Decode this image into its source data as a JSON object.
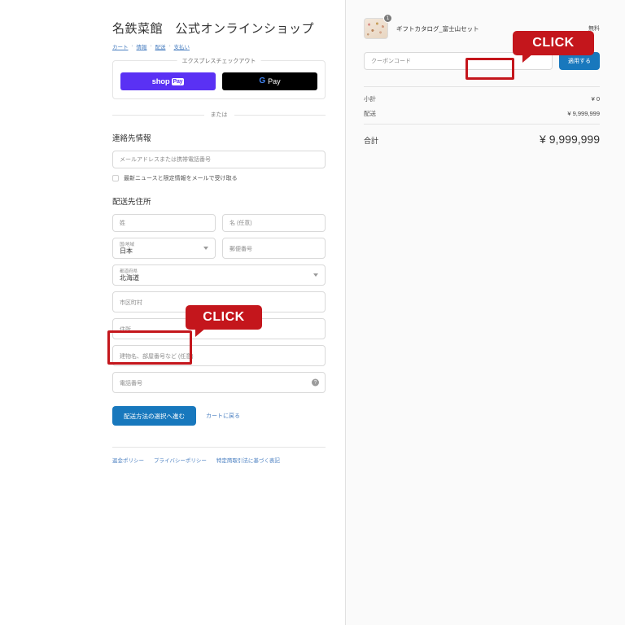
{
  "header": {
    "shop_title": "名鉄菜館　公式オンラインショップ"
  },
  "breadcrumb": {
    "items": [
      {
        "label": "カート"
      },
      {
        "label": "情報"
      },
      {
        "label": "配送"
      },
      {
        "label": "支払い"
      }
    ],
    "separator": "›"
  },
  "express_checkout": {
    "legend": "エクスプレスチェックアウト",
    "shop_pay": {
      "word": "shop",
      "chip": "Pay",
      "color": "#5a31f4"
    },
    "google_pay": {
      "g": "G",
      "word": "Pay",
      "color": "#000000"
    },
    "or_label": "または"
  },
  "contact": {
    "title": "連絡先情報",
    "email_placeholder": "メールアドレスまたは携帯電話番号",
    "newsletter_label": "最新ニュースと限定情報をメールで受け取る"
  },
  "shipping": {
    "title": "配送先住所",
    "last_name_placeholder": "姓",
    "first_name_placeholder": "名 (任意)",
    "country_label": "国/地域",
    "country_value": "日本",
    "postal_placeholder": "郵便番号",
    "prefecture_label": "都道府県",
    "prefecture_value": "北海道",
    "city_placeholder": "市区町村",
    "address_placeholder": "住所",
    "building_placeholder": "建物名、部屋番号など (任意)",
    "phone_placeholder": "電話番号",
    "phone_help_icon": "question-mark-icon"
  },
  "actions": {
    "submit_label": "配送方法の選択へ進む",
    "back_label": "カートに戻る",
    "accent_color": "#1878bd",
    "highlight_color": "#c4161c"
  },
  "footer": {
    "links": [
      {
        "label": "返金ポリシー"
      },
      {
        "label": "プライバシーポリシー"
      },
      {
        "label": "特定商取引法に基づく表記"
      }
    ]
  },
  "summary": {
    "line_items": [
      {
        "name": "ギフトカタログ_富士山セット",
        "quantity": "1",
        "price": "無料"
      }
    ],
    "coupon_placeholder": "クーポンコード",
    "coupon_button": "適用する",
    "totals": [
      {
        "label": "小計",
        "value": "¥ 0"
      },
      {
        "label": "配送",
        "value": "¥ 9,999,999"
      }
    ],
    "grand_total_label": "合計",
    "grand_total_value": "¥ 9,999,999"
  },
  "callouts": {
    "left": "CLICK",
    "right": "CLICK"
  }
}
